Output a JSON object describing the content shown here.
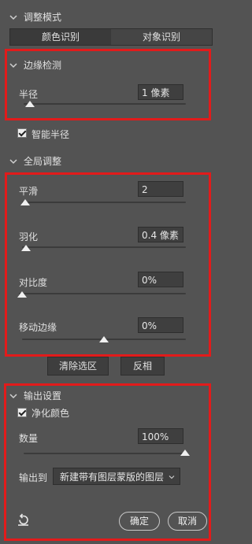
{
  "view_mode": {
    "title": "调整模式",
    "options": [
      "颜色识别",
      "对象识别"
    ],
    "selected": "颜色识别"
  },
  "edge_detection": {
    "title": "边缘检测",
    "radius_label": "半径",
    "radius_value": "1 像素",
    "radius_fraction": 0.05,
    "smart_radius_label": "智能半径",
    "smart_radius_checked": true
  },
  "global_refine": {
    "title": "全局调整",
    "smooth_label": "平滑",
    "smooth_value": "2",
    "smooth_fraction": 0.02,
    "feather_label": "羽化",
    "feather_value": "0.4 像素",
    "feather_fraction": 0.02,
    "contrast_label": "对比度",
    "contrast_value": "0%",
    "contrast_fraction": 0.0,
    "shift_edge_label": "移动边缘",
    "shift_edge_value": "0%",
    "shift_edge_fraction": 0.5,
    "clear_selection_label": "清除选区",
    "invert_label": "反相"
  },
  "output": {
    "title": "输出设置",
    "decontaminate_label": "净化颜色",
    "decontaminate_checked": true,
    "amount_label": "数量",
    "amount_value": "100%",
    "amount_fraction": 1.0,
    "output_to_label": "输出到",
    "output_to_value": "新建带有图层蒙版的图层"
  },
  "footer": {
    "ok_label": "确定",
    "cancel_label": "取消"
  },
  "colors": {
    "panel_bg": "#535353",
    "highlight_box": "#e21b1b"
  }
}
